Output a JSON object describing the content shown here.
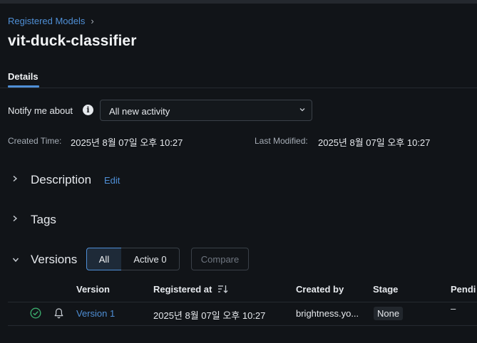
{
  "breadcrumb": {
    "parent_label": "Registered Models",
    "separator": "›"
  },
  "page": {
    "title": "vit-duck-classifier"
  },
  "tabs": [
    {
      "label": "Details",
      "active": true
    }
  ],
  "notify": {
    "label": "Notify me about",
    "info_icon": "info-icon",
    "selected": "All new activity"
  },
  "meta": {
    "created_label": "Created Time:",
    "created_value": "2025년 8월 07일 오후 10:27",
    "modified_label": "Last Modified:",
    "modified_value": "2025년 8월 07일 오후 10:27"
  },
  "sections": {
    "description": {
      "title": "Description",
      "edit_label": "Edit",
      "expanded": false
    },
    "tags": {
      "title": "Tags",
      "expanded": false
    },
    "versions": {
      "title": "Versions",
      "expanded": true
    }
  },
  "versions_toolbar": {
    "all_label": "All",
    "active_label": "Active 0",
    "compare_label": "Compare",
    "selected": "All"
  },
  "table": {
    "columns": [
      "Version",
      "Registered at",
      "Created by",
      "Stage",
      "Pendi"
    ],
    "rows": [
      {
        "status_icon": "check-circle-icon",
        "alert_icon": "bell-icon",
        "version": "Version 1",
        "registered_at": "2025년 8월 07일 오후 10:27",
        "created_by": "brightness.yo...",
        "stage": "None",
        "pending": "–"
      }
    ]
  },
  "colors": {
    "background": "#111418",
    "accent": "#4f8fd6",
    "status_ok": "#3aa86b"
  }
}
